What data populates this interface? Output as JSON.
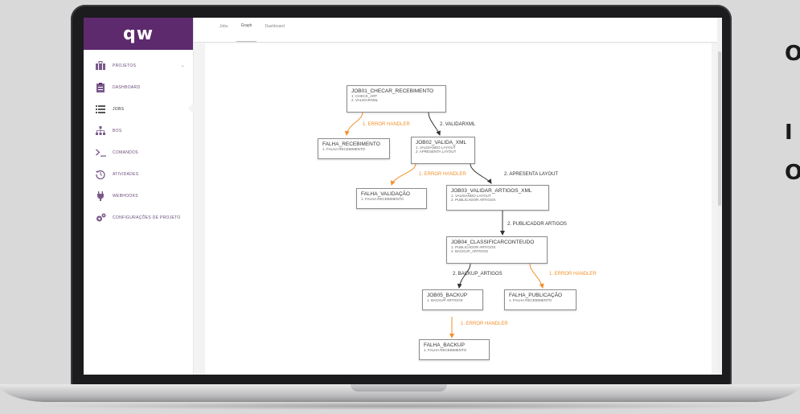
{
  "logo": {
    "text": "qw"
  },
  "sidebar": {
    "items": [
      {
        "label": "PROJETOS",
        "icon": "briefcase-icon",
        "active": false,
        "chevron": "⌄"
      },
      {
        "label": "DASHBOARD",
        "icon": "clipboard-icon",
        "active": false
      },
      {
        "label": "JOBS",
        "icon": "list-icon",
        "active": true
      },
      {
        "label": "BOS",
        "icon": "sitemap-icon",
        "active": false
      },
      {
        "label": "COMANDOS",
        "icon": "terminal-icon",
        "active": false
      },
      {
        "label": "ATIVIDADES",
        "icon": "history-icon",
        "active": false
      },
      {
        "label": "WEBHOOKS",
        "icon": "plug-icon",
        "active": false
      },
      {
        "label": "CONFIGURAÇÕES DE PROJETO",
        "icon": "cogs-icon",
        "active": false
      }
    ]
  },
  "tabs": [
    {
      "label": "Jobs",
      "active": false
    },
    {
      "label": "Graph",
      "active": true
    },
    {
      "label": "Dashboard",
      "active": false
    }
  ],
  "graph": {
    "nodes": {
      "job01": {
        "title": "JOB01_CHECAR_RECEBIMENTO",
        "steps": [
          "1. CHECK_ART",
          "2. VALIDARXML"
        ]
      },
      "falha_recebimento": {
        "title": "FALHA_RECEBIMENTO",
        "steps": [
          "1. FALHA RECEBIMENTO"
        ]
      },
      "job02": {
        "title": "JOB02_VALIDA_XML",
        "steps": [
          "1. VALIDANDO LAYOUT",
          "2. APRESENTA LAYOUT"
        ]
      },
      "falha_validacao": {
        "title": "FALHA_VALIDAÇÃO",
        "steps": [
          "1. FALHA RECEBIMENTO"
        ]
      },
      "job03": {
        "title": "JOB03_VALIDAR_ARTIGOS_XML",
        "steps": [
          "1. VALIDANDO LAYOUT",
          "2. PUBLICADOR ARTIGOS"
        ]
      },
      "job04": {
        "title": "JOB04_CLASSIFICARCONTEUDO",
        "steps": [
          "1. PUBLICADOR ARTIGOS",
          "2. BACKUP_ARTIGOS"
        ]
      },
      "job05": {
        "title": "JOB05_BACKUP",
        "steps": [
          "1. BACKUP ARTIGOS"
        ]
      },
      "falha_publicacao": {
        "title": "FALHA_PUBLICAÇÃO",
        "steps": [
          "1. FALHA RECEBIMENTO"
        ]
      },
      "falha_backup": {
        "title": "FALHA_BACKUP",
        "steps": [
          "1. FALHA RECEBIMENTO"
        ]
      }
    },
    "edge_labels": {
      "e1": "1. ERROR HANDLER",
      "e2": "2. VALIDARXML",
      "e3": "1. ERROR HANDLER",
      "e4": "2. APRESENTA LAYOUT",
      "e5": "2. PUBLICADOR ARTIGOS",
      "e6": "2. BACKUP_ARTIGOS",
      "e7": "1. ERROR HANDLER",
      "e8": "1. ERROR HANDLER"
    },
    "colors": {
      "error_edge": "#f2912a",
      "normal_edge": "#333333"
    }
  },
  "side_text": {
    "line1": "O",
    "line2": "I",
    "line3": "O"
  },
  "colors": {
    "brand": "#5d2a6e",
    "accent_orange": "#f2912a"
  }
}
